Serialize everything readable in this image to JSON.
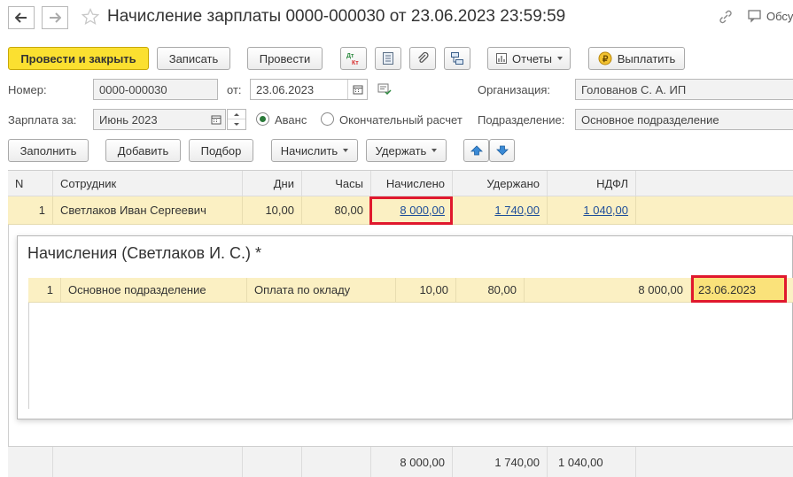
{
  "window": {
    "title": "Начисление зарплаты 0000-000030 от 23.06.2023 23:59:59",
    "discuss_label": "Обсу"
  },
  "toolbar": {
    "post_close": "Провести и закрыть",
    "save": "Записать",
    "post": "Провести",
    "dt_kt_label": "Дт Кт",
    "reports": "Отчеты",
    "pay": "Выплатить"
  },
  "header": {
    "number_label": "Номер:",
    "number_value": "0000-000030",
    "date_label": "от:",
    "date_value": "23.06.2023",
    "org_label": "Организация:",
    "org_value": "Голованов С. А. ИП",
    "salary_for_label": "Зарплата за:",
    "salary_for_value": "Июнь 2023",
    "radio_advance": "Аванс",
    "radio_final": "Окончательный расчет",
    "dept_label": "Подразделение:",
    "dept_value": "Основное подразделение"
  },
  "actions": {
    "fill": "Заполнить",
    "add": "Добавить",
    "select": "Подбор",
    "accrue": "Начислить",
    "withhold": "Удержать"
  },
  "table": {
    "columns": [
      "N",
      "Сотрудник",
      "Дни",
      "Часы",
      "Начислено",
      "Удержано",
      "НДФЛ"
    ],
    "rows": [
      {
        "n": "1",
        "employee": "Светлаков Иван Сергеевич",
        "days": "10,00",
        "hours": "80,00",
        "accrued": "8 000,00",
        "withheld": "1 740,00",
        "ndfl": "1 040,00"
      }
    ],
    "totals": {
      "accrued": "8 000,00",
      "withheld": "1 740,00",
      "ndfl": "1 040,00"
    }
  },
  "popup": {
    "title": "Начисления (Светлаков И. С.) *",
    "rows": [
      {
        "n": "1",
        "department": "Основное подразделение",
        "type": "Оплата по окладу",
        "days": "10,00",
        "hours": "80,00",
        "amount": "8 000,00",
        "date": "23.06.2023"
      }
    ]
  },
  "colors": {
    "primary_button": "#fbe030",
    "selected_row": "#fbf0c3",
    "highlight_border": "#e0182d",
    "link": "#1f4e9a"
  }
}
